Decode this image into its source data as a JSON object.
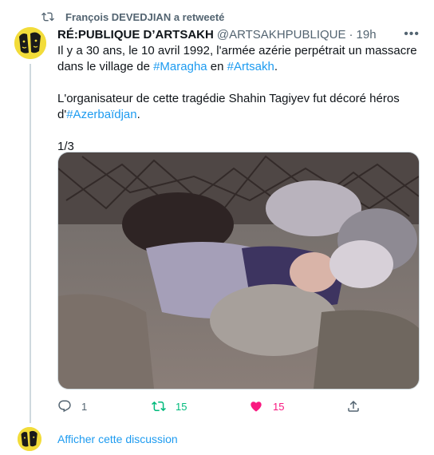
{
  "retweet": {
    "label": "François DEVEDJIAN a retweeté"
  },
  "tweet": {
    "author_name": "RÉ:PUBLIQUE D’ARTSAKH",
    "handle": "@ARTSAKHPUBLIQUE",
    "separator": "·",
    "time": "19h",
    "line1_a": "Il y a 30 ans, le 10 avril 1992, l'armée azérie perpétrait un massacre dans le village de ",
    "hashtag_maragha": "#Maragha",
    "line1_b": " en ",
    "hashtag_artsakh": "#Artsakh",
    "line1_c": ".",
    "line2_a": "L'organisateur de cette tragédie Shahin Tagiyev fut décoré héros d'",
    "hashtag_azerbaidjan": "#Azerbaïdjan",
    "line2_b": ".",
    "line3": "1/3"
  },
  "actions": {
    "reply_count": "1",
    "retweet_count": "15",
    "like_count": "15"
  },
  "show_thread": {
    "label": "Afficher cette discussion"
  },
  "colors": {
    "link": "#1d9bf0",
    "retweet": "#00ba7c",
    "like": "#f91880",
    "muted": "#536471",
    "avatar_bg": "#f2dc3a"
  },
  "icons": [
    "retweet-icon",
    "avatar",
    "more-icon",
    "reply-icon",
    "retweet-icon",
    "heart-icon",
    "share-icon"
  ]
}
